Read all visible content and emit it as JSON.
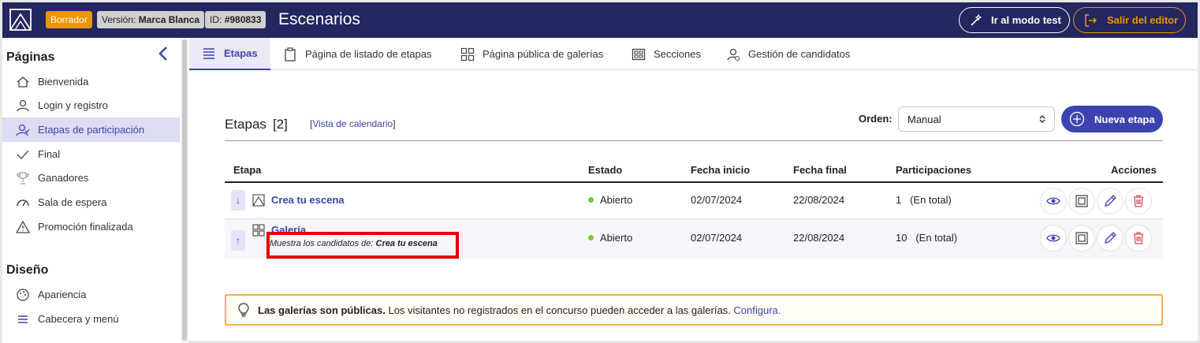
{
  "topbar": {
    "badge_draft": "Borrador",
    "version_label": "Versión:",
    "version_value": "Marca Blanca",
    "id_label": "ID:",
    "id_value": "#980833",
    "title": "Escenarios",
    "test_button": "Ir al modo test",
    "exit_button": "Salir del editor"
  },
  "sidebar": {
    "pages_heading": "Páginas",
    "pages": [
      {
        "label": "Bienvenida",
        "icon": "home-icon"
      },
      {
        "label": "Login y registro",
        "icon": "user-icon"
      },
      {
        "label": "Etapas de participación",
        "icon": "users-icon",
        "active": true
      },
      {
        "label": "Final",
        "icon": "check-icon"
      },
      {
        "label": "Ganadores",
        "icon": "trophy-icon"
      },
      {
        "label": "Sala de espera",
        "icon": "gauge-icon"
      },
      {
        "label": "Promoción finalizada",
        "icon": "warning-icon"
      }
    ],
    "design_heading": "Diseño",
    "design": [
      {
        "label": "Apariencia",
        "icon": "palette-icon"
      },
      {
        "label": "Cabecera y menú",
        "icon": "menu-icon"
      }
    ]
  },
  "tabs": [
    {
      "label": "Etapas",
      "icon": "list-icon",
      "active": true
    },
    {
      "label": "Página de listado de etapas",
      "icon": "clipboard-icon"
    },
    {
      "label": "Página pública de galerías",
      "icon": "grid-icon"
    },
    {
      "label": "Secciones",
      "icon": "sections-icon"
    },
    {
      "label": "Gestión de candidatos",
      "icon": "candidates-icon"
    }
  ],
  "stages": {
    "title": "Etapas",
    "count": "[2]",
    "calendar_open": "[",
    "calendar_link": "Vista de calendario",
    "calendar_close": "]",
    "order_label": "Orden:",
    "order_value": "Manual",
    "new_button": "Nueva etapa",
    "columns": [
      "Etapa",
      "Estado",
      "Fecha inicio",
      "Fecha final",
      "Participaciones",
      "Acciones"
    ],
    "rows": [
      {
        "arrow": "↓",
        "name": "Crea tu escena",
        "subtitle_prefix": "",
        "subtitle_value": "",
        "status": "Abierto",
        "start": "02/07/2024",
        "end": "22/08/2024",
        "count": "1",
        "count_suffix": "(En total)"
      },
      {
        "arrow": "↑",
        "name": "Galería",
        "subtitle_prefix": "Muestra los candidatos de:",
        "subtitle_value": "Crea tu escena",
        "status": "Abierto",
        "start": "02/07/2024",
        "end": "22/08/2024",
        "count": "10",
        "count_suffix": "(En total)"
      }
    ]
  },
  "notice": {
    "bold": "Las galerías son públicas.",
    "text": "Los visitantes no registrados en el concurso pueden acceder a las galerías.",
    "link": "Configura."
  },
  "colors": {
    "topbar": "#23265f",
    "accent": "#3c43b0",
    "draft": "#f29300",
    "open_status": "#7ac943",
    "highlight": "#e00000",
    "notice_border": "#f0b24a"
  }
}
